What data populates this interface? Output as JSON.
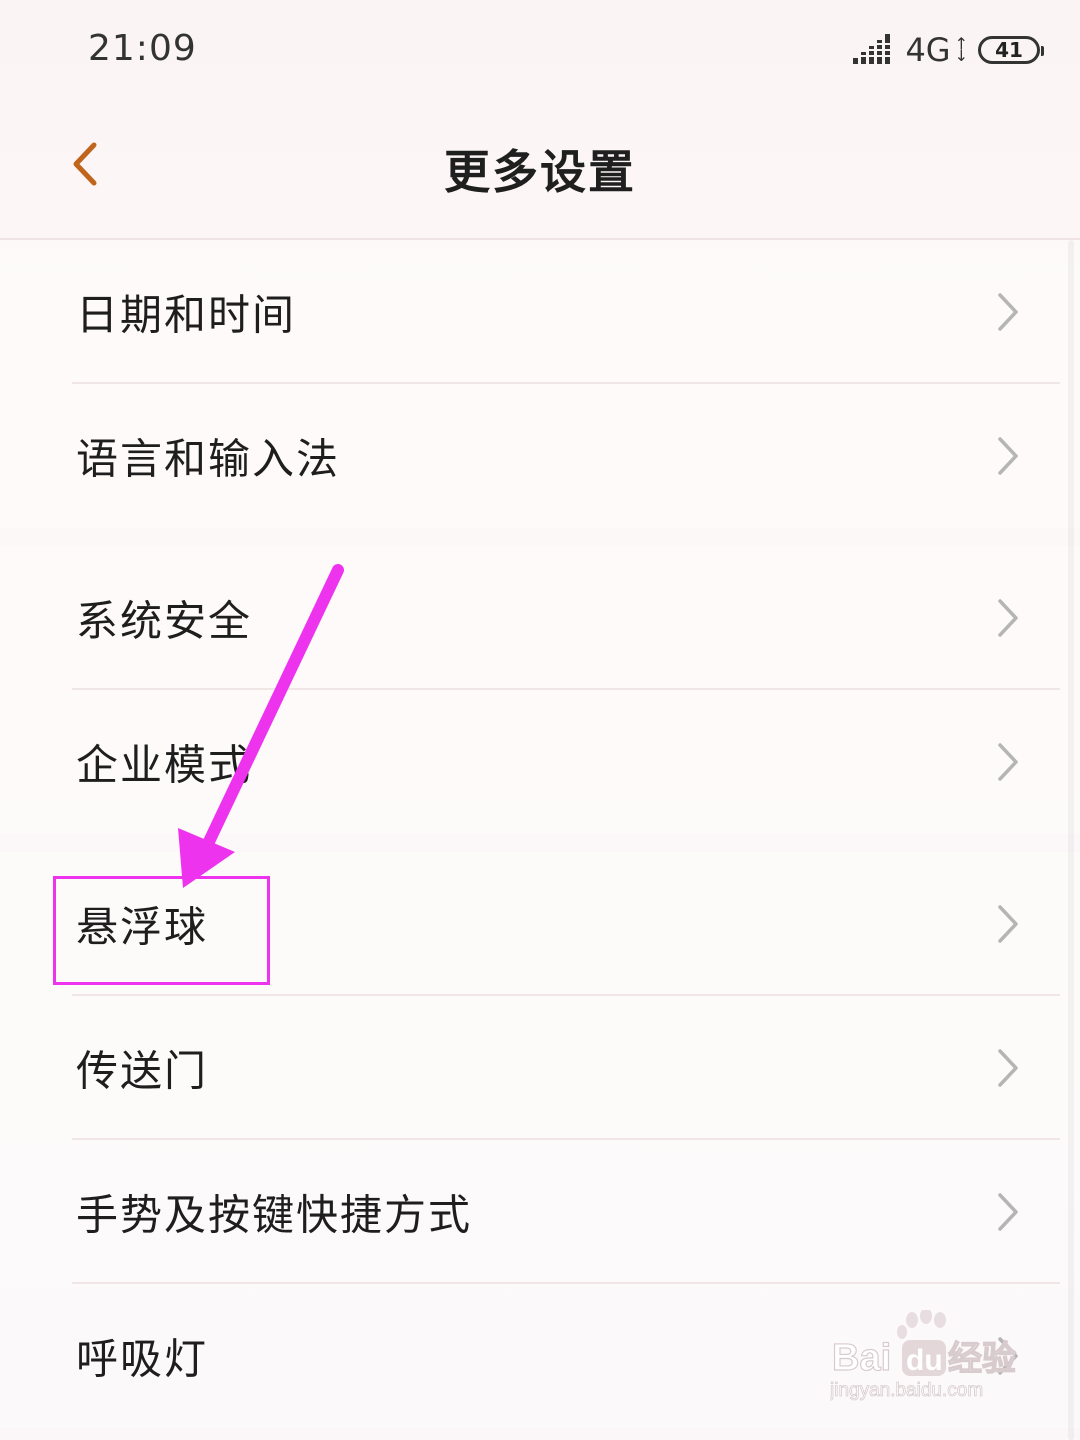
{
  "status_bar": {
    "time": "21:09",
    "network": "4G",
    "battery": "41"
  },
  "header": {
    "title": "更多设置"
  },
  "groups": [
    {
      "items": [
        {
          "label": "日期和时间"
        },
        {
          "label": "语言和输入法"
        }
      ]
    },
    {
      "items": [
        {
          "label": "系统安全"
        },
        {
          "label": "企业模式"
        }
      ]
    },
    {
      "items": [
        {
          "label": "悬浮球"
        },
        {
          "label": "传送门"
        },
        {
          "label": "手势及按键快捷方式"
        },
        {
          "label": "呼吸灯"
        }
      ]
    }
  ],
  "annotation": {
    "color": "#ee33ee"
  },
  "watermark": {
    "brand": "Bai",
    "brand_suffix": "du",
    "product": "经验",
    "url": "jingyan.baidu.com"
  },
  "colors": {
    "back_chevron": "#c0651b",
    "chevron": "#b5b5b5"
  }
}
